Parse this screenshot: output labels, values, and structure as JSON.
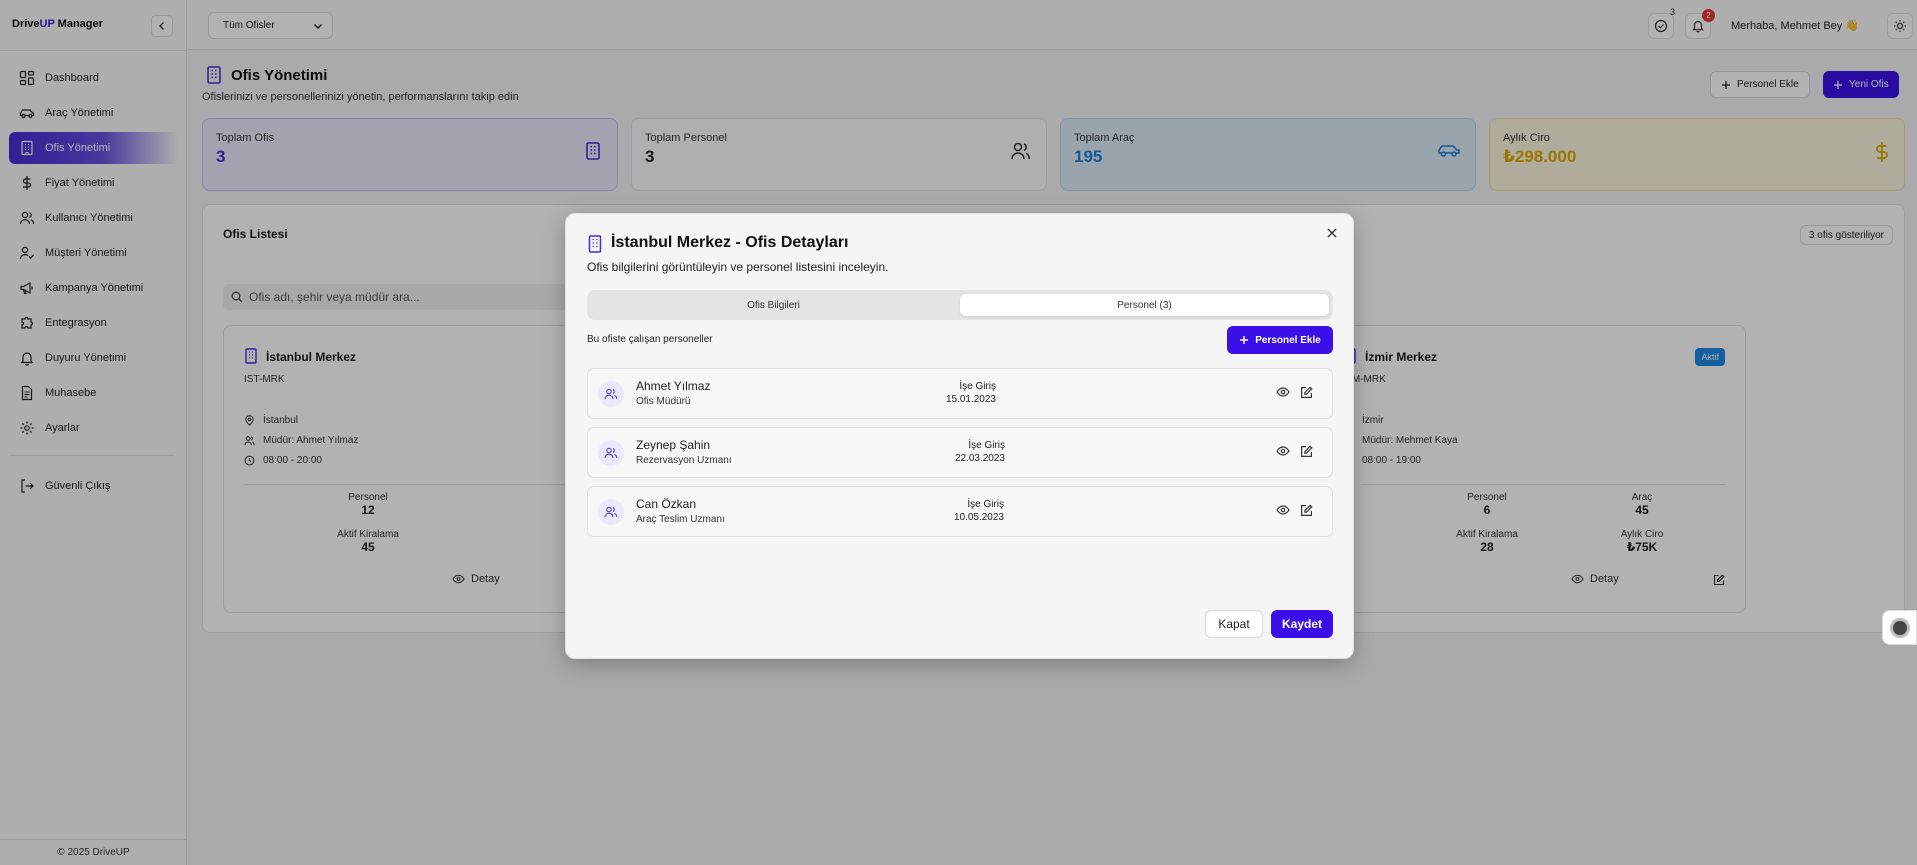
{
  "app": {
    "brand_prefix": "Drive",
    "brand_highlight": "UP",
    "brand_suffix": " Manager",
    "footer": "© 2025 DriveUP"
  },
  "sidebar": {
    "items": [
      {
        "label": "Dashboard",
        "icon": "dashboard-icon"
      },
      {
        "label": "Araç Yönetimi",
        "icon": "car-icon"
      },
      {
        "label": "Ofis Yönetimi",
        "icon": "building-icon",
        "active": true
      },
      {
        "label": "Fiyat Yönetimi",
        "icon": "dollar-icon"
      },
      {
        "label": "Kullanıcı Yönetimi",
        "icon": "users-icon"
      },
      {
        "label": "Müşteri Yönetimi",
        "icon": "user-check-icon"
      },
      {
        "label": "Kampanya Yönetimi",
        "icon": "megaphone-icon"
      },
      {
        "label": "Entegrasyon",
        "icon": "puzzle-icon"
      },
      {
        "label": "Duyuru Yönetimi",
        "icon": "bell-icon"
      },
      {
        "label": "Muhasebe",
        "icon": "document-icon"
      },
      {
        "label": "Ayarlar",
        "icon": "gear-icon"
      }
    ],
    "logout": "Güvenli Çıkış"
  },
  "header": {
    "office_select": "Tüm Ofisler",
    "tasks_badge": "3",
    "notifications_badge": "2",
    "greeting": "Merhaba, Mehmet Bey 👋"
  },
  "page": {
    "title": "Ofis Yönetimi",
    "subtitle": "Ofislerinizi ve personellerinizi yönetin, performanslarını takip edin",
    "add_staff": "Personel Ekle",
    "new_office": "Yeni Ofis"
  },
  "stats": [
    {
      "label": "Toplam Ofis",
      "value": "3",
      "color": "#4a2bd6"
    },
    {
      "label": "Toplam Personel",
      "value": "3",
      "color": "#222222"
    },
    {
      "label": "Toplam Araç",
      "value": "195",
      "color": "#1e7fd6"
    },
    {
      "label": "Aylık Ciro",
      "value": "₺298.000",
      "color": "#e0a800"
    }
  ],
  "office_list": {
    "title": "Ofis Listesi",
    "count": "3 ofis gösteriliyor",
    "search_placeholder": "Ofis adı, şehir veya müdür ara...",
    "cards": [
      {
        "name": "İstanbul Merkez",
        "code": "IST-MRK",
        "city": "İstanbul",
        "manager": "Müdür: Ahmet Yılmaz",
        "hours": "08:00 - 20:00",
        "stats": [
          {
            "label": "Personel",
            "value": "12"
          },
          {
            "label": "Aktif Kiralama",
            "value": "45"
          }
        ],
        "detail": "Detay"
      },
      {
        "name": "İzmir Merkez",
        "code": "IZM-MRK",
        "city": "İzmir",
        "manager": "Müdür: Mehmet Kaya",
        "hours": "08:00 - 19:00",
        "badge": "Aktif",
        "stats": [
          {
            "label": "Personel",
            "value": "6"
          },
          {
            "label": "Araç",
            "value": "45"
          },
          {
            "label": "Aktif Kiralama",
            "value": "28"
          },
          {
            "label": "Aylık Ciro",
            "value": "₺75K"
          }
        ],
        "detail": "Detay"
      }
    ]
  },
  "modal": {
    "title": "İstanbul Merkez - Ofis Detayları",
    "description": "Ofis bilgilerini görüntüleyin ve personel listesini inceleyin.",
    "tabs": [
      "Ofis Bilgileri",
      "Personel (3)"
    ],
    "active_tab": "Personel (3)",
    "staff_label": "Bu ofiste çalışan personeller",
    "add_button": "Personel Ekle",
    "date_label": "İşe Giriş",
    "staff": [
      {
        "name": "Ahmet Yılmaz",
        "role": "Ofis Müdürü",
        "date": "15.01.2023"
      },
      {
        "name": "Zeynep Şahin",
        "role": "Rezervasyon Uzmanı",
        "date": "22.03.2023"
      },
      {
        "name": "Can Özkan",
        "role": "Araç Teslim Uzmanı",
        "date": "10.05.2023"
      }
    ],
    "close_button": "Kapat",
    "save_button": "Kaydet"
  }
}
